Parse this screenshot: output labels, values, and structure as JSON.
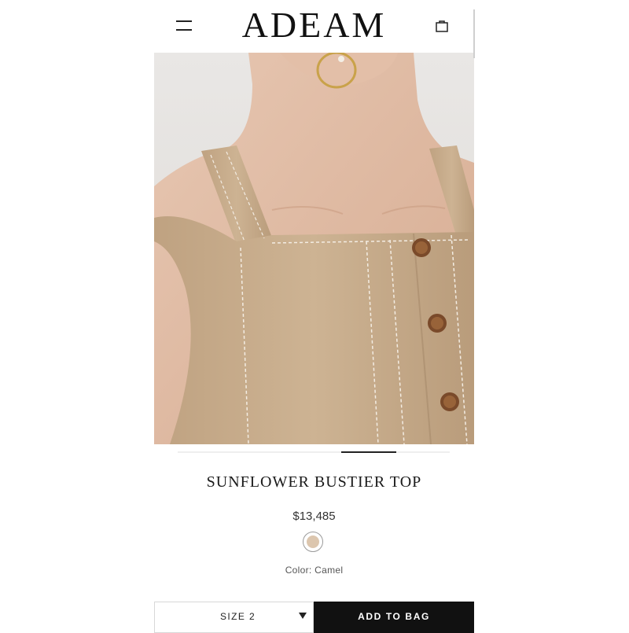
{
  "header": {
    "logo": "ADEAM",
    "menu_icon": "menu-icon",
    "bag_icon": "shopping-bag-icon"
  },
  "product": {
    "title": "SUNFLOWER BUSTIER TOP",
    "price": "$13,485",
    "color_label": "Color: Camel",
    "swatch_color": "#dcc6ae",
    "image_index_active": 4,
    "image_count": 5
  },
  "actions": {
    "size_value": "SIZE 2",
    "add_to_bag": "ADD TO BAG"
  },
  "colors": {
    "fabric": "#c8ad8d",
    "button_primary": "#111111"
  }
}
